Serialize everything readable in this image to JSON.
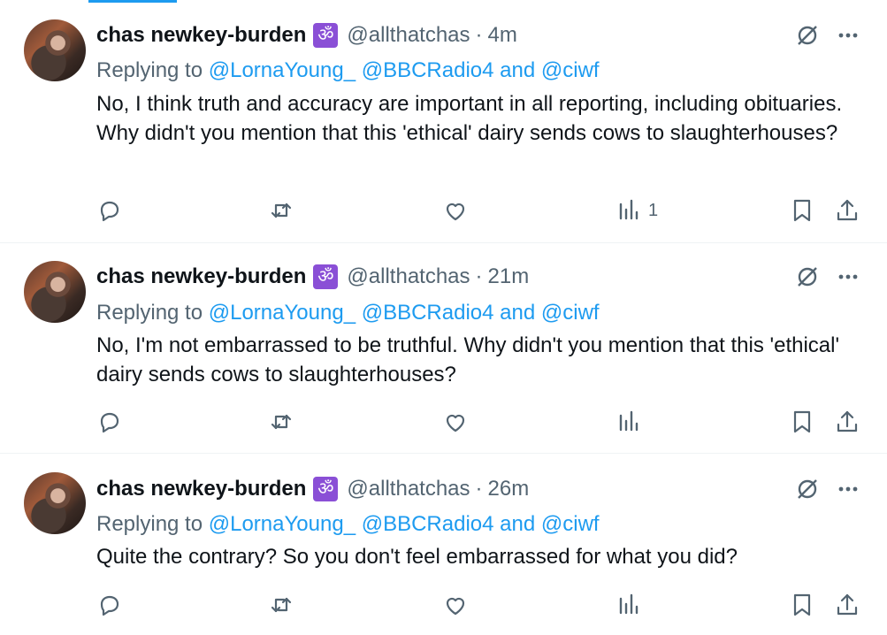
{
  "tweets": [
    {
      "author": "chas newkey-burden",
      "badge": "ॐ",
      "handle": "@allthatchas",
      "separator": "·",
      "time": "4m",
      "replying_prefix": "Replying to",
      "mentions_a": "@LornaYoung_ @BBCRadio4",
      "and": "and",
      "mention_b": "@ciwf",
      "text": "No, I think truth and accuracy are important in all reporting, including obituaries. Why didn't you mention that this 'ethical' dairy sends cows to slaughterhouses?",
      "views": "1"
    },
    {
      "author": "chas newkey-burden",
      "badge": "ॐ",
      "handle": "@allthatchas",
      "separator": "·",
      "time": "21m",
      "replying_prefix": "Replying to",
      "mentions_a": "@LornaYoung_ @BBCRadio4",
      "and": "and",
      "mention_b": "@ciwf",
      "text": "No, I'm not embarrassed to be truthful. Why didn't you mention that this 'ethical' dairy sends cows to slaughterhouses?",
      "views": ""
    },
    {
      "author": "chas newkey-burden",
      "badge": "ॐ",
      "handle": "@allthatchas",
      "separator": "·",
      "time": "26m",
      "replying_prefix": "Replying to",
      "mentions_a": "@LornaYoung_ @BBCRadio4",
      "and": "and",
      "mention_b": "@ciwf",
      "text": "Quite the contrary? So you don't feel embarrassed for what you did?",
      "views": ""
    }
  ],
  "icons": {
    "header": [
      "grok-icon",
      "more-icon"
    ],
    "actions": [
      "reply-icon",
      "retweet-icon",
      "like-icon",
      "views-icon",
      "bookmark-icon",
      "share-icon"
    ]
  },
  "colors": {
    "link": "#1d9bf0",
    "muted": "#536471",
    "text": "#0f1419",
    "badge": "#8a4fd6"
  }
}
